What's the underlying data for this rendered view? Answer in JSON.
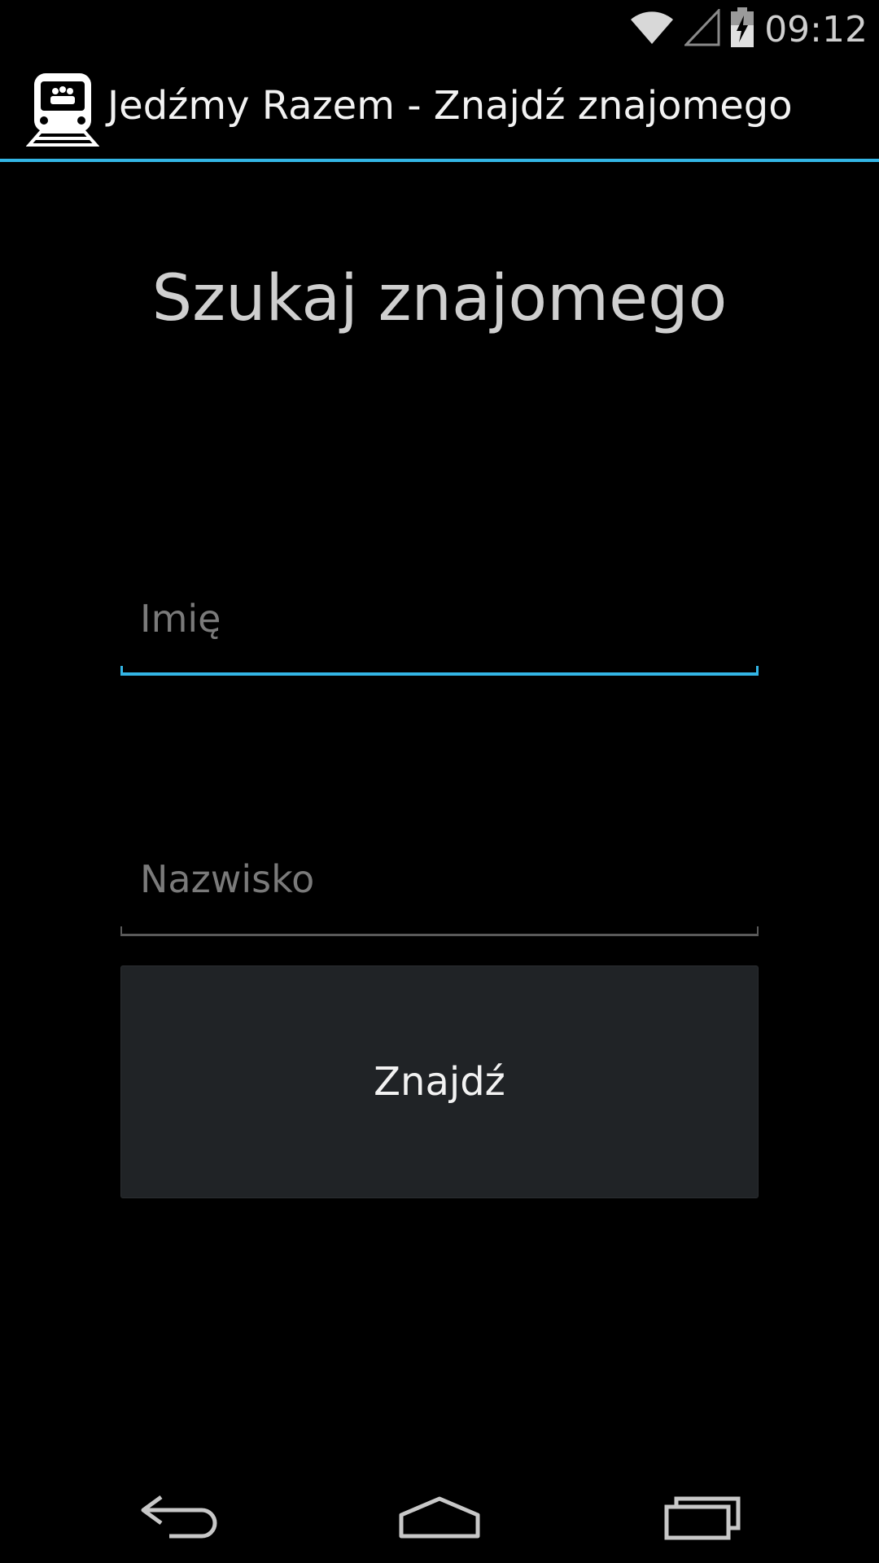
{
  "status_bar": {
    "time": "09:12",
    "icons": [
      "wifi-icon",
      "signal-icon",
      "battery-charging-icon"
    ]
  },
  "action_bar": {
    "title": "Jedźmy Razem - Znajdź znajomego",
    "icon": "train-icon",
    "accent_color": "#33b5e5"
  },
  "main": {
    "heading": "Szukaj znajomego",
    "first_name": {
      "placeholder": "Imię",
      "value": ""
    },
    "last_name": {
      "placeholder": "Nazwisko",
      "value": ""
    },
    "find_button_label": "Znajdź"
  },
  "nav_bar": {
    "icons": [
      "back-icon",
      "home-icon",
      "recent-apps-icon"
    ]
  }
}
